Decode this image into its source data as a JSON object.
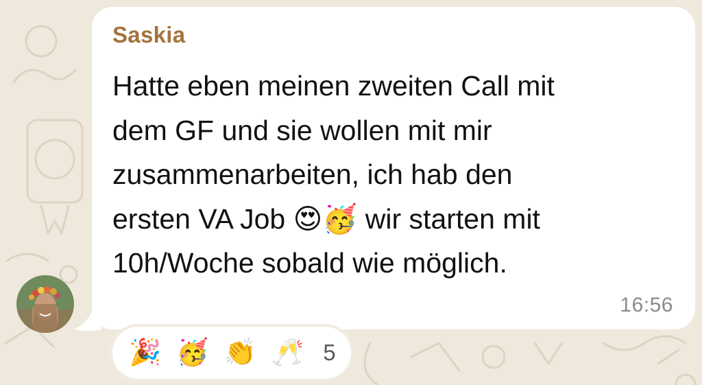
{
  "chat": {
    "background_color": "#efe8dc",
    "bubble_color": "#ffffff"
  },
  "message": {
    "sender": "Saskia",
    "sender_color": "#a3743a",
    "text": "Hatte eben meinen zweiten Call mit\ndem GF und sie wollen mit mir\nzusammenarbeiten, ich hab den\nersten VA Job 😍🥳 wir starten mit\n10h/Woche sobald wie möglich.",
    "time": "16:56"
  },
  "reactions": {
    "emojis": [
      "🎉",
      "🥳",
      "👏",
      "🥂"
    ],
    "count": "5"
  },
  "avatar": {
    "icon": "user-avatar-photo"
  }
}
